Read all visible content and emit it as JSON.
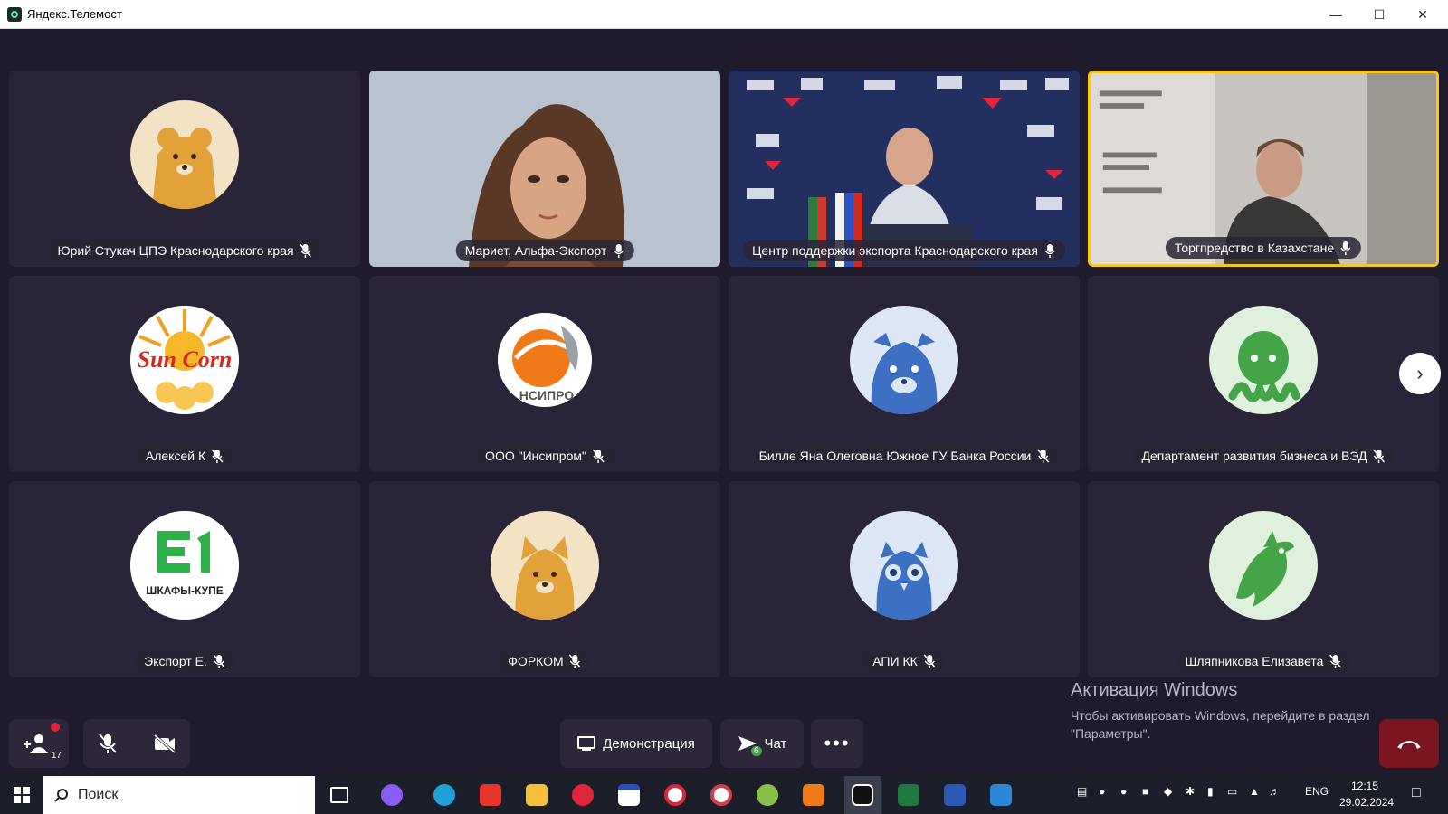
{
  "window": {
    "title": "Яндекс.Телемост"
  },
  "participants": [
    {
      "name": "Юрий Стукач ЦПЭ Краснодарского края",
      "type": "avatar",
      "avatar_color": "#f2e3c4",
      "icon": "bear-icon",
      "mic": "muted"
    },
    {
      "name": "Мариет, Альфа-Экспорт",
      "type": "video",
      "mic": "on"
    },
    {
      "name": "Центр поддержки экспорта Краснодарского края",
      "type": "video",
      "mic": "on"
    },
    {
      "name": "Торгпредство в Казахстане",
      "type": "video",
      "mic": "on",
      "active": true
    },
    {
      "name": "Алексей К",
      "type": "avatar",
      "logo_text": "Sun Corn",
      "mic": "muted"
    },
    {
      "name": "ООО \"Инсипром\"",
      "type": "avatar",
      "logo_text": "НСИПРО",
      "mic": "muted"
    },
    {
      "name": "Билле Яна Олеговна Южное ГУ Банка России",
      "type": "avatar",
      "avatar_color": "#dde6f5",
      "icon": "tiger-icon",
      "mic": "muted"
    },
    {
      "name": "Департамент развития бизнеса и ВЭД",
      "type": "avatar",
      "avatar_color": "#dff0dd",
      "icon": "octopus-icon",
      "mic": "muted"
    },
    {
      "name": "Экспорт Е.",
      "type": "avatar",
      "logo_text": "ШКАФЫ-КУПЕ",
      "mic": "muted"
    },
    {
      "name": "ФОРКОМ",
      "type": "avatar",
      "avatar_color": "#f2e3c4",
      "icon": "cat-icon",
      "mic": "muted"
    },
    {
      "name": "АПИ КК",
      "type": "avatar",
      "avatar_color": "#dde6f5",
      "icon": "owl-icon",
      "mic": "muted"
    },
    {
      "name": "Шляпникова Елизавета",
      "type": "avatar",
      "avatar_color": "#dff0dd",
      "icon": "dolphin-icon",
      "mic": "muted"
    }
  ],
  "controls": {
    "participants_count": "17",
    "demo_label": "Демонстрация",
    "chat_label": "Чат",
    "chat_badge": "6"
  },
  "watermark": {
    "heading": "Активация Windows",
    "line1": "Чтобы активировать Windows, перейдите в раздел",
    "line2": "\"Параметры\"."
  },
  "taskbar": {
    "search_placeholder": "Поиск",
    "lang": "ENG",
    "time": "12:15",
    "date": "29.02.2024"
  },
  "colors": {
    "background": "#1f1a2c",
    "tile": "#2a2438",
    "active_border": "#f6c81f",
    "avatar_orange": "#e3a13a",
    "avatar_blue": "#3d6fc2",
    "avatar_green": "#43a547",
    "hangup": "#7a1620"
  }
}
